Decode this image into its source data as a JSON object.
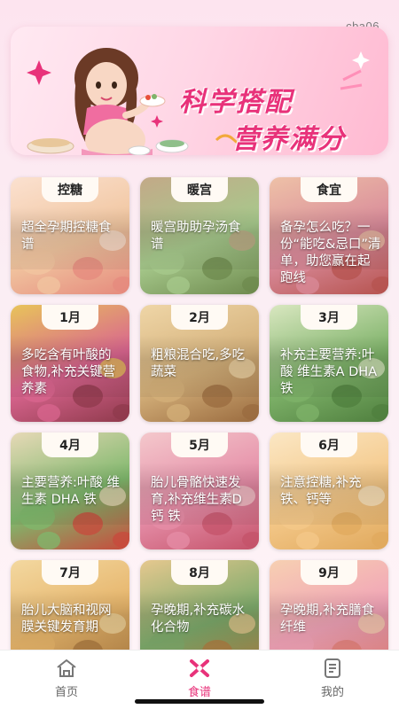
{
  "watermark": "cba06",
  "banner": {
    "title": "科学搭配",
    "subtitle": "营养满分"
  },
  "cards": [
    {
      "tag": "控糖",
      "text": "超全孕期控糖食谱",
      "colors": [
        "#f1c6a0",
        "#e58a7d",
        "#fbe1d0"
      ]
    },
    {
      "tag": "暖宫",
      "text": "暖宫助助孕汤食谱",
      "colors": [
        "#a7c98c",
        "#6e8a4e",
        "#c3a988"
      ]
    },
    {
      "tag": "食宜",
      "text": "备孕怎么吃？一份“能吃&忌口”清单，助您赢在起跑线",
      "colors": [
        "#d98b9a",
        "#b6534f",
        "#eec1a7"
      ]
    },
    {
      "tag": "1月",
      "text": "多吃含有叶酸的食物,补充关键营养素",
      "colors": [
        "#d9658f",
        "#8f3a4c",
        "#e8c45a"
      ]
    },
    {
      "tag": "2月",
      "text": "粗粮混合吃,多吃蔬菜",
      "colors": [
        "#d4b07a",
        "#9a6b3f",
        "#efd6a7"
      ]
    },
    {
      "tag": "3月",
      "text": "补充主要营养:叶酸 维生素A DHA 铁",
      "colors": [
        "#7fb36a",
        "#4f7f3e",
        "#d9e7c0"
      ]
    },
    {
      "tag": "4月",
      "text": "主要营养:叶酸 维生素 DHA 铁",
      "colors": [
        "#7fb86c",
        "#c84a3c",
        "#e7d9b7"
      ]
    },
    {
      "tag": "5月",
      "text": "胎儿骨骼快速发育,补充维生素D 钙 铁",
      "colors": [
        "#e58da7",
        "#c4536a",
        "#f4c8cc"
      ]
    },
    {
      "tag": "6月",
      "text": "注意控糖,补充铁、钙等",
      "colors": [
        "#f4c889",
        "#e0a95d",
        "#fbe7c4"
      ]
    },
    {
      "tag": "7月",
      "text": "胎儿大脑和视网膜关键发育期",
      "colors": [
        "#e6b46a",
        "#a7763d",
        "#f3d8a0"
      ]
    },
    {
      "tag": "8月",
      "text": "孕晚期,补充碳水化合物",
      "colors": [
        "#7daa6b",
        "#b07a3f",
        "#e6c88f"
      ]
    },
    {
      "tag": "9月",
      "text": "孕晚期,补充膳食纤维",
      "colors": [
        "#f1a3b7",
        "#e27d74",
        "#f7d0b2"
      ]
    }
  ],
  "tabbar": {
    "items": [
      {
        "label": "首页",
        "icon": "home-icon",
        "active": false
      },
      {
        "label": "食谱",
        "icon": "recipe-icon",
        "active": true
      },
      {
        "label": "我的",
        "icon": "profile-icon",
        "active": false
      }
    ],
    "active_color": "#e8327a",
    "inactive_color": "#666666"
  }
}
